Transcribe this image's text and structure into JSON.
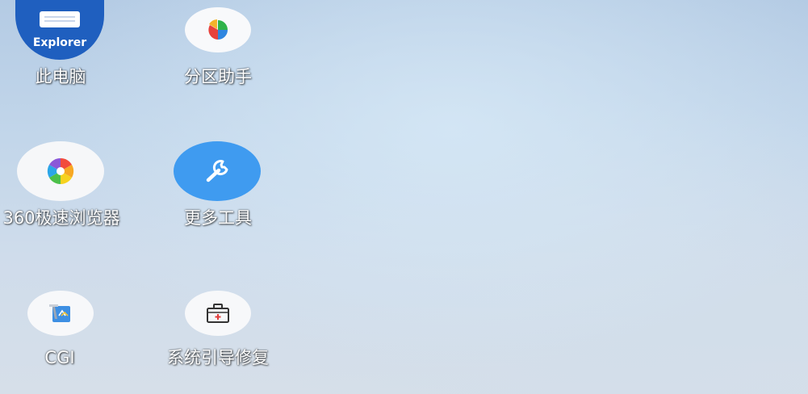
{
  "desktop": {
    "icons": [
      {
        "id": "this-pc",
        "label": "此电脑",
        "badge": "Explorer",
        "icon": "explorer-icon"
      },
      {
        "id": "partition-assistant",
        "label": "分区助手",
        "icon": "pie-chart-icon"
      },
      {
        "id": "browser-360",
        "label": "360极速浏览器",
        "icon": "swirl-browser-icon"
      },
      {
        "id": "more-tools",
        "label": "更多工具",
        "icon": "wrench-icon"
      },
      {
        "id": "cgi",
        "label": "CGI",
        "icon": "cgi-backup-icon"
      },
      {
        "id": "boot-repair",
        "label": "系统引导修复",
        "icon": "toolbox-icon"
      }
    ]
  },
  "colors": {
    "explorer_blue": "#1f5fbf",
    "tools_blue": "#3f9bf0",
    "label_text": "#ffffff"
  }
}
